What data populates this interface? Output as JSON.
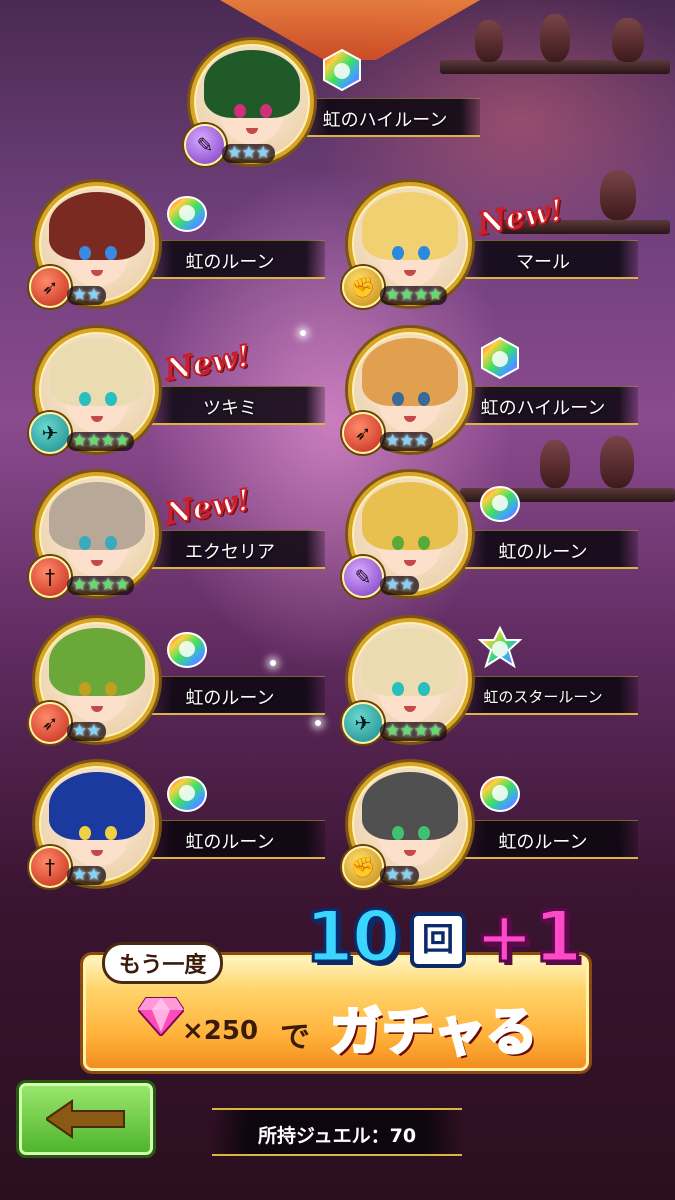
{
  "colors": {
    "accent": "#d9a526",
    "rainbow": "#ff5ad0",
    "button_green": "#4cb22a"
  },
  "results": [
    {
      "name": "虹のハイルーン",
      "rarity": 3,
      "class_icon": "staff-icon",
      "rune_icon": "rainbow-hexagon-rune-icon",
      "is_new": false,
      "hair": "#1f5a28",
      "eye": "#d0307a"
    },
    {
      "name": "虹のルーン",
      "rarity": 2,
      "class_icon": "bow-icon",
      "rune_icon": "rainbow-rune-icon",
      "is_new": false,
      "hair": "#7a2a20",
      "eye": "#3a8adf"
    },
    {
      "name": "マール",
      "rarity": 4,
      "class_icon": "fist-icon",
      "rune_icon": null,
      "is_new": true,
      "hair": "#f0d070",
      "eye": "#2a8adf"
    },
    {
      "name": "ツキミ",
      "rarity": 4,
      "class_icon": "bird-icon",
      "rune_icon": null,
      "is_new": true,
      "hair": "#eadbb0",
      "eye": "#2abfbf"
    },
    {
      "name": "虹のハイルーン",
      "rarity": 3,
      "class_icon": "bow-icon",
      "rune_icon": "rainbow-hexagon-rune-icon",
      "is_new": false,
      "hair": "#e0a050",
      "eye": "#3a6a9a"
    },
    {
      "name": "エクセリア",
      "rarity": 4,
      "class_icon": "sword-icon",
      "rune_icon": null,
      "is_new": true,
      "hair": "#b8a898",
      "eye": "#3aaabf"
    },
    {
      "name": "虹のルーン",
      "rarity": 2,
      "class_icon": "staff-icon",
      "rune_icon": "rainbow-rune-icon",
      "is_new": false,
      "hair": "#e8c050",
      "eye": "#5aaa3a"
    },
    {
      "name": "虹のルーン",
      "rarity": 2,
      "class_icon": "bow-icon",
      "rune_icon": "rainbow-rune-icon",
      "is_new": false,
      "hair": "#6aa83a",
      "eye": "#c0a020"
    },
    {
      "name": "虹のスタールーン",
      "rarity": 4,
      "class_icon": "bird-icon",
      "rune_icon": "rainbow-star-rune-icon",
      "is_new": false,
      "hair": "#eadbb0",
      "eye": "#2abfbf"
    },
    {
      "name": "虹のルーン",
      "rarity": 2,
      "class_icon": "sword-icon",
      "rune_icon": "rainbow-rune-icon",
      "is_new": false,
      "hair": "#1a3aa0",
      "eye": "#f0d040"
    },
    {
      "name": "虹のルーン",
      "rarity": 2,
      "class_icon": "fist-icon",
      "rune_icon": "rainbow-rune-icon",
      "is_new": false,
      "hair": "#505050",
      "eye": "#40c070"
    }
  ],
  "new_label": "New!",
  "banner": {
    "again": "もう一度",
    "count": "10",
    "count_unit": "回",
    "bonus": "+1",
    "multiplier": "×250",
    "de": "で",
    "action": "ガチャる"
  },
  "footer": {
    "jewel_text": "所持ジュエル：70",
    "back_icon": "left-arrow-icon"
  }
}
